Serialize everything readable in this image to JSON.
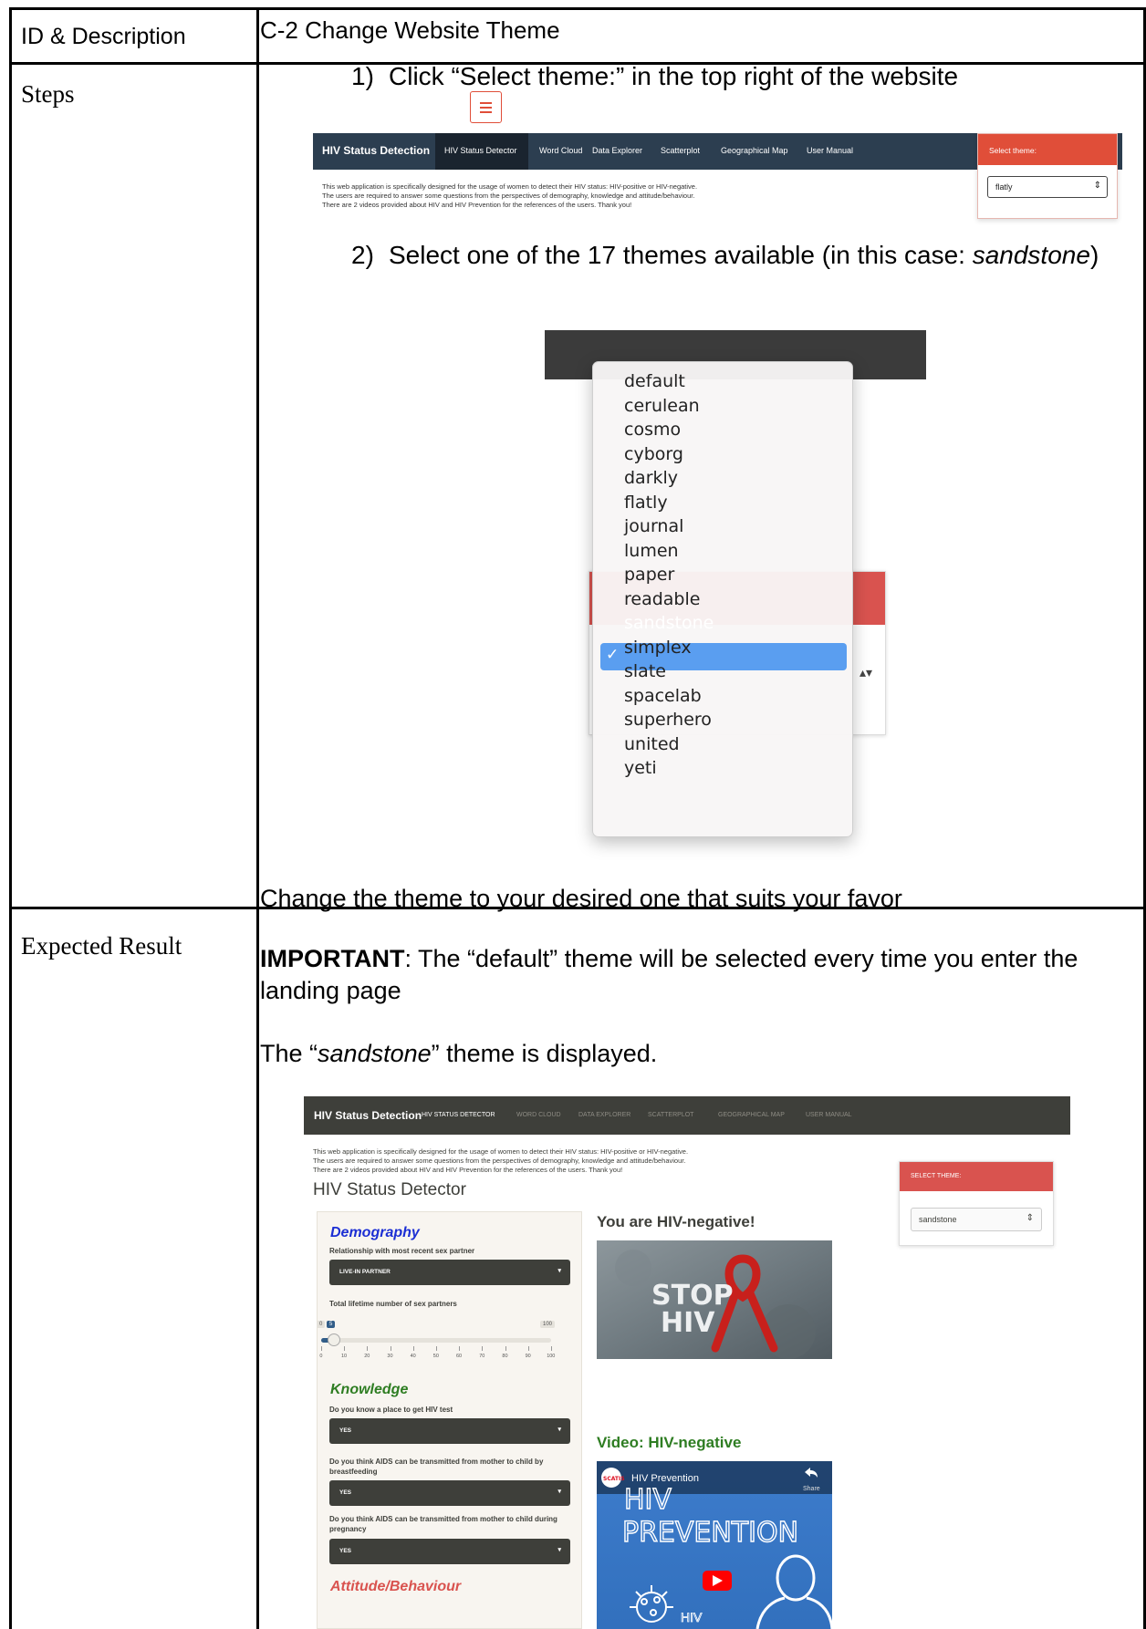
{
  "table": {
    "row1_label": "ID & Description",
    "row1_value": "C-2 Change Website Theme",
    "row2_label": "Steps",
    "row3_label": "Expected Result"
  },
  "steps": {
    "step1_num": "1)",
    "step1_text": "Click “Select theme:” in the top right of the website",
    "step2_num": "2)",
    "step2_text_a": "Select one of the 17 themes available (in this case: ",
    "step2_em": "sandstone",
    "step2_text_b": ")",
    "change_note": "Change the theme to your desired one that suits your favor",
    "important_label": "IMPORTANT",
    "important_line1": ": The “default” theme will be selected every time you enter the",
    "important_line2": "landing page"
  },
  "expected": {
    "text_a": "The “",
    "text_em": "sandstone",
    "text_b": "” theme is displayed."
  },
  "shot1": {
    "brand": "HIV Status Detection",
    "nav": [
      "HIV Status Detector",
      "Word Cloud",
      "Data Explorer",
      "Scatterplot",
      "Geographical Map",
      "User Manual"
    ],
    "intro": [
      "This web application is specifically designed for the usage of women to detect their HIV status: HIV-positive or HIV-negative.",
      "The users are required to answer some questions from the perspectives of demography, knowledge and attitude/behaviour.",
      "There are 2 videos provided about HIV and HIV Prevention for the references of the users. Thank you!"
    ],
    "theme_label": "Select theme:",
    "theme_value": "flatly",
    "select_arrow": "⇕",
    "navbar_color": "#2c3e50",
    "accent_color": "#e04e39"
  },
  "dropdown": {
    "themes": [
      "default",
      "cerulean",
      "cosmo",
      "cyborg",
      "darkly",
      "flatly",
      "journal",
      "lumen",
      "paper",
      "readable",
      "sandstone",
      "simplex",
      "slate",
      "spacelab",
      "superhero",
      "united",
      "yeti"
    ],
    "selected_index": 10,
    "check": "✓",
    "arrows": "▴▾",
    "highlight_color": "#5a9ef0"
  },
  "shot3": {
    "brand": "HIV Status Detection",
    "nav": [
      "HIV STATUS DETECTOR",
      "WORD CLOUD",
      "DATA EXPLORER",
      "SCATTERPLOT",
      "GEOGRAPHICAL MAP",
      "USER MANUAL"
    ],
    "intro": [
      "This web application is specifically designed for the usage of women to detect their HIV status: HIV-positive or HIV-negative.",
      "The users are required to answer some questions from the perspectives of demography, knowledge and attitude/behaviour.",
      "There are 2 videos provided about HIV and HIV Prevention for the references of the users. Thank you!"
    ],
    "page_title": "HIV Status Detector",
    "theme_label": "SELECT THEME:",
    "theme_value": "sandstone",
    "select_arrow": "⇕",
    "caret": "▾",
    "sections": {
      "demography": "Demography",
      "knowledge": "Knowledge",
      "attitude_partial": "Attitude/Behaviour"
    },
    "questions": {
      "q1": "Relationship with most recent sex partner",
      "q1_value": "LIVE-IN PARTNER",
      "q2": "Total lifetime number of sex partners",
      "slider_min": "0",
      "slider_value": "5",
      "slider_max": "100",
      "slider_ticks": [
        "0",
        "10",
        "20",
        "30",
        "40",
        "50",
        "60",
        "70",
        "80",
        "90",
        "100"
      ],
      "q3": "Do you know a place to get HIV test",
      "q3_value": "YES",
      "q4": "Do you think AIDS can be transmitted from mother to child by breastfeeding",
      "q4_value": "YES",
      "q5": "Do you think AIDS can be transmitted from mother to child during pregnancy",
      "q5_value": "YES"
    },
    "result_title": "You are HIV-negative!",
    "stop_line1": "STOP",
    "stop_line2": "HIV",
    "video_title": "Video: HIV-negative",
    "video_channel": "SCATIS",
    "video_name": "HIV Prevention",
    "video_big1": "HIV",
    "video_big2": "PREVENTION",
    "video_share": "Share",
    "video_tag": "HIV",
    "navbar_color": "#3e3f3a",
    "primary_color": "#325d88",
    "demography_color": "#1c2fd4",
    "knowledge_color": "#2e7d22",
    "result_color": "#3e3f3a",
    "video_title_color": "#2e7d22"
  }
}
